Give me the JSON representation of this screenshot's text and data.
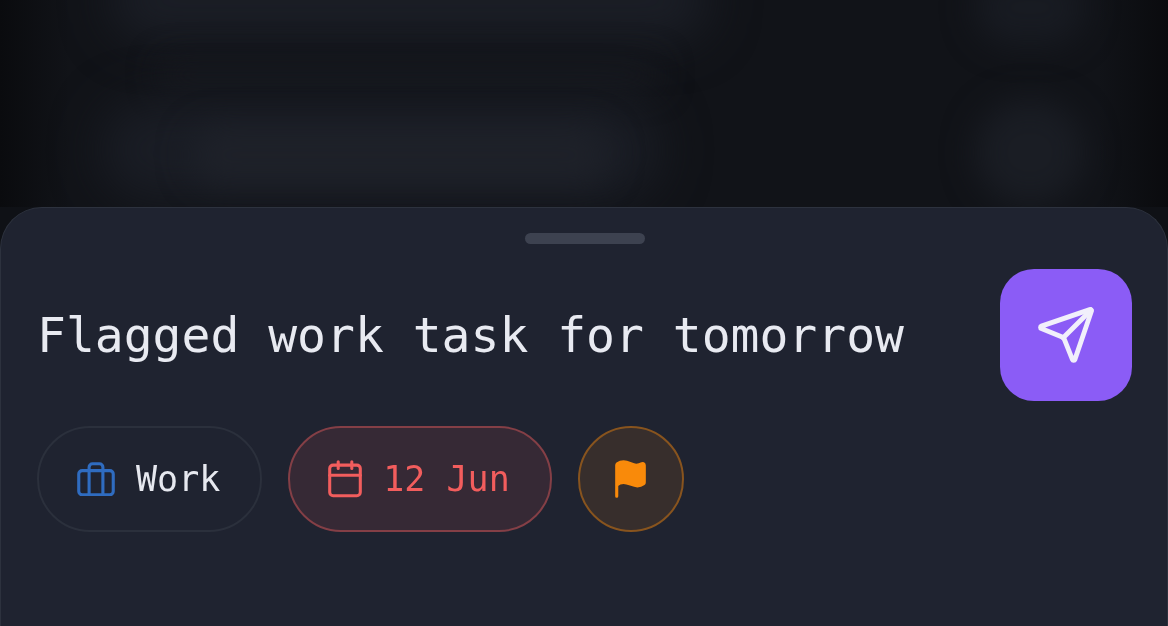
{
  "task_input": {
    "value": "Flagged work task for tomorrow"
  },
  "chips": [
    {
      "kind": "project",
      "label": "Work",
      "color": "#2f6cc0",
      "highlighted": false
    },
    {
      "kind": "date",
      "label": "12 Jun",
      "color": "#f25d5d",
      "highlighted": true
    },
    {
      "kind": "flag",
      "color": "#f98a0a",
      "highlighted": true
    }
  ]
}
